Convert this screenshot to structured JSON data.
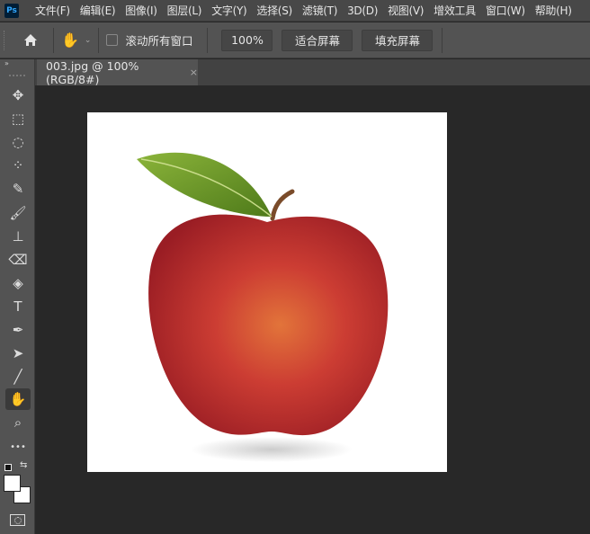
{
  "app": {
    "logo": "Ps"
  },
  "menu": [
    "文件(F)",
    "编辑(E)",
    "图像(I)",
    "图层(L)",
    "文字(Y)",
    "选择(S)",
    "滤镜(T)",
    "3D(D)",
    "视图(V)",
    "增效工具",
    "窗口(W)",
    "帮助(H)"
  ],
  "options": {
    "scroll_all_label": "滚动所有窗口",
    "zoom_value": "100%",
    "fit_screen": "适合屏幕",
    "fill_screen": "填充屏幕"
  },
  "document": {
    "tab_title": "003.jpg @ 100%(RGB/8#)",
    "close": "×"
  },
  "tools": [
    {
      "name": "move-tool",
      "glyph": "✥"
    },
    {
      "name": "marquee-tool",
      "glyph": "⬚"
    },
    {
      "name": "lasso-tool",
      "glyph": "◌"
    },
    {
      "name": "quick-select-tool",
      "glyph": "⁘"
    },
    {
      "name": "eyedropper-tool",
      "glyph": "✎"
    },
    {
      "name": "brush-tool",
      "glyph": "🖌"
    },
    {
      "name": "stamp-tool",
      "glyph": "⊥"
    },
    {
      "name": "eraser-tool",
      "glyph": "⌫"
    },
    {
      "name": "paint-bucket-tool",
      "glyph": "◈"
    },
    {
      "name": "type-tool",
      "glyph": "T"
    },
    {
      "name": "pen-tool",
      "glyph": "✒"
    },
    {
      "name": "path-select-tool",
      "glyph": "➤"
    },
    {
      "name": "line-tool",
      "glyph": "╱"
    },
    {
      "name": "hand-tool",
      "glyph": "✋"
    },
    {
      "name": "zoom-tool",
      "glyph": "⌕"
    },
    {
      "name": "more-tools",
      "glyph": "•••"
    }
  ]
}
